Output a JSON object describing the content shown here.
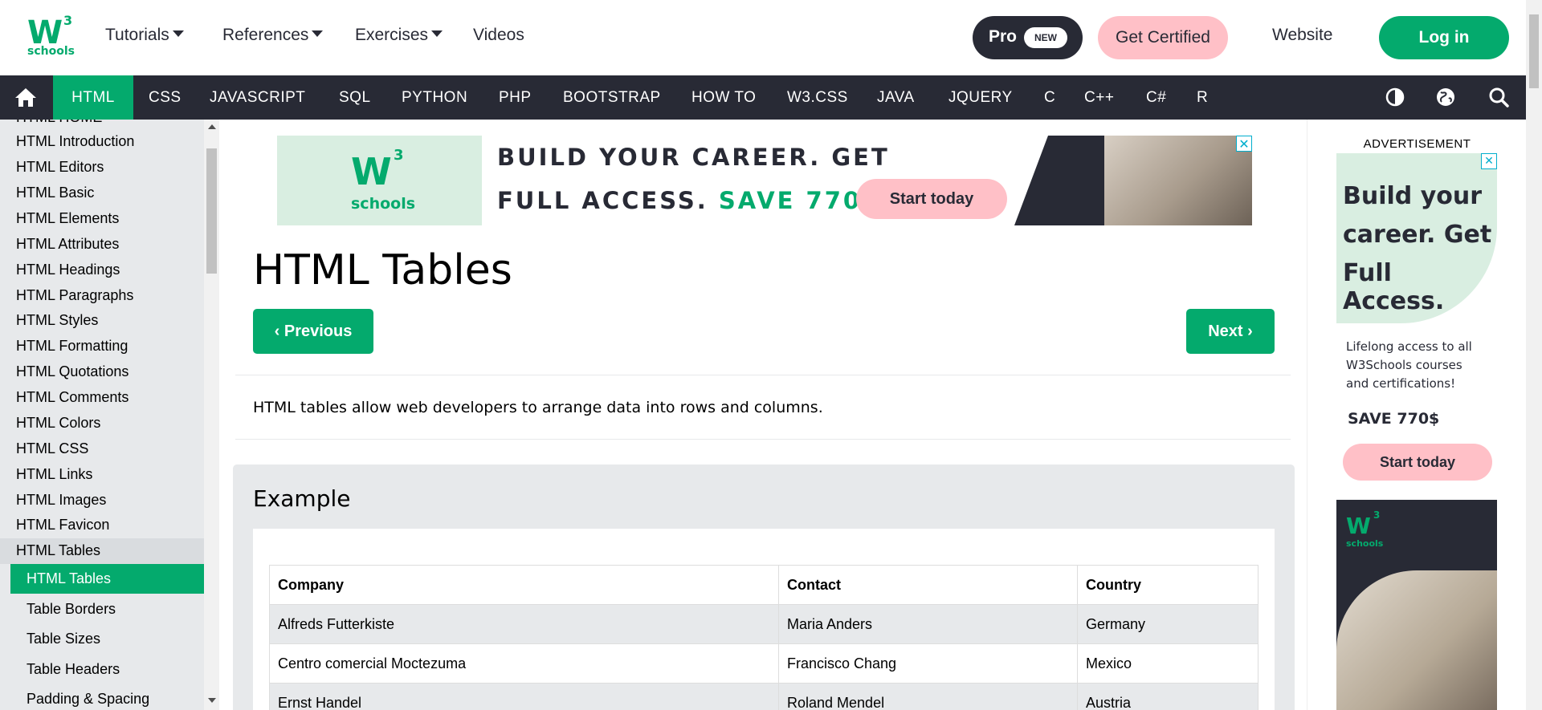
{
  "header": {
    "logo": {
      "main": "W",
      "superscript": "3",
      "sub": "schools"
    },
    "nav": [
      {
        "label": "Tutorials",
        "dropdown": true
      },
      {
        "label": "References",
        "dropdown": true
      },
      {
        "label": "Exercises",
        "dropdown": true
      },
      {
        "label": "Videos",
        "dropdown": false
      }
    ],
    "pro_label": "Pro",
    "pro_badge": "NEW",
    "certified_label": "Get Certified",
    "website_label": "Website",
    "login_label": "Log in"
  },
  "topics_nav": {
    "home_icon": "home-icon",
    "items": [
      "HTML",
      "CSS",
      "JAVASCRIPT",
      "SQL",
      "PYTHON",
      "PHP",
      "BOOTSTRAP",
      "HOW TO",
      "W3.CSS",
      "JAVA",
      "JQUERY",
      "C",
      "C++",
      "C#",
      "R"
    ],
    "active": "HTML",
    "icons": [
      "contrast-icon",
      "globe-icon",
      "search-icon"
    ]
  },
  "sidebar": {
    "partial_top": "HTML HOME",
    "items": [
      "HTML Introduction",
      "HTML Editors",
      "HTML Basic",
      "HTML Elements",
      "HTML Attributes",
      "HTML Headings",
      "HTML Paragraphs",
      "HTML Styles",
      "HTML Formatting",
      "HTML Quotations",
      "HTML Comments",
      "HTML Colors",
      "HTML CSS",
      "HTML Links",
      "HTML Images",
      "HTML Favicon"
    ],
    "section": "HTML Tables",
    "sub_items": [
      "HTML Tables",
      "Table Borders",
      "Table Sizes",
      "Table Headers",
      "Padding & Spacing"
    ],
    "active_sub": "HTML Tables"
  },
  "banner": {
    "logo_main": "W",
    "logo_sup": "3",
    "logo_sub": "schools",
    "line1": "BUILD YOUR CAREER. GET",
    "line2_prefix": "FULL ACCESS.",
    "line2_highlight": "SAVE 770$",
    "button": "Start today",
    "close": "✕"
  },
  "main": {
    "title": "HTML Tables",
    "prev_label": "Previous",
    "next_label": "Next",
    "intro": "HTML tables allow web developers to arrange data into rows and columns.",
    "example_title": "Example",
    "table": {
      "headers": [
        "Company",
        "Contact",
        "Country"
      ],
      "rows": [
        [
          "Alfreds Futterkiste",
          "Maria Anders",
          "Germany"
        ],
        [
          "Centro comercial Moctezuma",
          "Francisco Chang",
          "Mexico"
        ],
        [
          "Ernst Handel",
          "Roland Mendel",
          "Austria"
        ]
      ]
    }
  },
  "ad": {
    "label": "ADVERTISEMENT",
    "heading": [
      "Build your",
      "career. Get",
      "Full Access."
    ],
    "body": [
      "Lifelong access to all",
      "W3Schools courses",
      "and certifications!"
    ],
    "save": "SAVE 770$",
    "button": "Start today",
    "close": "✕",
    "logo_main": "W",
    "logo_sup": "3",
    "logo_sub": "schools"
  },
  "colors": {
    "brand_green": "#04AA6D",
    "dark": "#282A35",
    "pink": "#FFC0C7",
    "light_gray": "#E7E9EB"
  }
}
